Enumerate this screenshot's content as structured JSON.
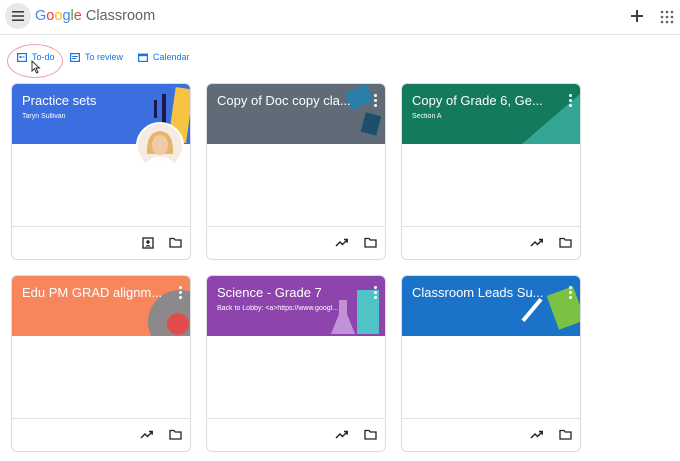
{
  "header": {
    "logo_google": [
      "G",
      "o",
      "o",
      "g",
      "l",
      "e"
    ],
    "logo_colors": [
      "#4285F4",
      "#EA4335",
      "#FBBC05",
      "#4285F4",
      "#34A853",
      "#EA4335"
    ],
    "product": "Classroom",
    "icons": {
      "menu": "hamburger-menu-icon",
      "add": "plus-icon",
      "apps": "apps-grid-icon"
    }
  },
  "nav": {
    "items": [
      {
        "label": "To-do",
        "icon": "assignment-icon"
      },
      {
        "label": "To review",
        "icon": "review-icon"
      },
      {
        "label": "Calendar",
        "icon": "calendar-icon"
      }
    ],
    "accent": "#1a73e8",
    "highlight": "#f0a0a6"
  },
  "cards": [
    {
      "title": "Practice sets",
      "subtitle": "Taryn Sullivan",
      "color": "#3b6fe0",
      "footer_icons": [
        "portfolio-icon",
        "folder-icon"
      ],
      "has_avatar": true
    },
    {
      "title": "Copy of Doc copy cla...",
      "subtitle": "",
      "color": "#5f6b76",
      "footer_icons": [
        "trending-icon",
        "folder-icon"
      ]
    },
    {
      "title": "Copy of Grade 6, Ge...",
      "subtitle": "Section A",
      "color": "#137a5e",
      "footer_icons": [
        "trending-icon",
        "folder-icon"
      ]
    },
    {
      "title": "Edu PM GRAD alignm...",
      "subtitle": "",
      "color": "#f7865d",
      "footer_icons": [
        "trending-icon",
        "folder-icon"
      ]
    },
    {
      "title": "Science - Grade 7",
      "subtitle": "Back to Lobby: <a>https://www.googl...",
      "color": "#8e44ad",
      "footer_icons": [
        "trending-icon",
        "folder-icon"
      ]
    },
    {
      "title": "Classroom Leads Su...",
      "subtitle": "",
      "color": "#1a73c8",
      "footer_icons": [
        "trending-icon",
        "folder-icon"
      ]
    }
  ]
}
